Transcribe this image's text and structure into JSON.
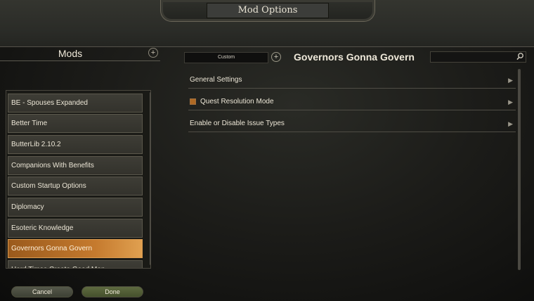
{
  "window": {
    "title": "Mod Options"
  },
  "mods_panel": {
    "title": "Mods",
    "add_icon": "plus-circle-icon",
    "items": [
      {
        "label": "BE - Spouses Expanded",
        "selected": false
      },
      {
        "label": "Better Time",
        "selected": false
      },
      {
        "label": "ButterLib 2.10.2",
        "selected": false
      },
      {
        "label": "Companions With Benefits",
        "selected": false
      },
      {
        "label": "Custom Startup Options",
        "selected": false
      },
      {
        "label": "Diplomacy",
        "selected": false
      },
      {
        "label": "Esoteric Knowledge",
        "selected": false
      },
      {
        "label": "Governors Gonna Govern",
        "selected": true
      },
      {
        "label": "Hard Times Create Good Men",
        "selected": false
      }
    ]
  },
  "footer": {
    "cancel_label": "Cancel",
    "done_label": "Done"
  },
  "header": {
    "preset_value": "Custom",
    "add_preset_icon": "plus-circle-icon",
    "mod_title": "Governors Gonna Govern",
    "search_value": "",
    "search_icon": "search-icon"
  },
  "settings": [
    {
      "label": "General Settings",
      "has_checkbox": false,
      "expand_icon": "chevron-right-icon"
    },
    {
      "label": "Quest Resolution Mode",
      "has_checkbox": true,
      "checked": true,
      "expand_icon": "chevron-right-icon"
    },
    {
      "label": "Enable or Disable Issue Types",
      "has_checkbox": false,
      "expand_icon": "chevron-right-icon"
    }
  ],
  "colors": {
    "selected_accent": "#c57a2e",
    "done_button": "#5e6a40",
    "cancel_button": "#55584a"
  }
}
